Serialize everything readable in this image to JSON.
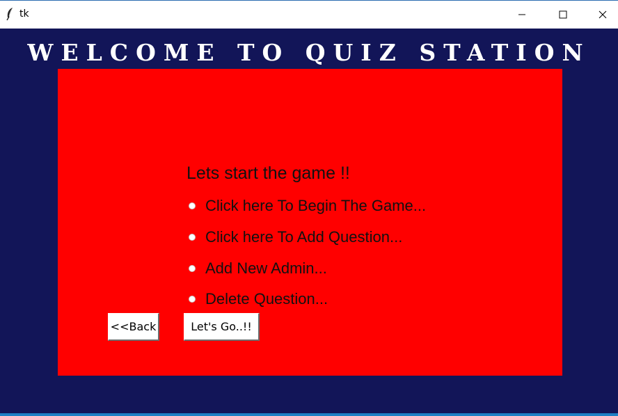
{
  "window": {
    "title": "tk",
    "icon": "feather-icon",
    "controls": [
      "minimize-icon",
      "maximize-icon",
      "close-icon"
    ]
  },
  "heading": "WELCOME TO QUIZ STATION",
  "panel": {
    "prompt": "Lets start the game !!",
    "options": [
      {
        "label": "Click here To Begin The Game..."
      },
      {
        "label": "Click here To Add Question..."
      },
      {
        "label": "Add New Admin..."
      },
      {
        "label": "Delete Question..."
      }
    ],
    "back_button": "<<Back",
    "go_button": "Let's Go..!!"
  },
  "colors": {
    "window_background": "#121558",
    "panel_background": "#ff0000",
    "heading_text": "#ffffff"
  }
}
